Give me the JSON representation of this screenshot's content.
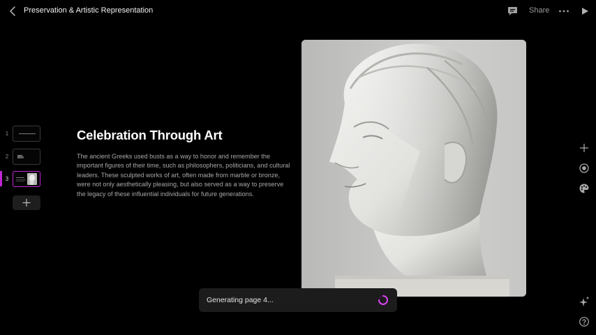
{
  "header": {
    "title": "Preservation & Artistic Representation",
    "share_label": "Share",
    "icons": [
      "chevron-left-icon",
      "comment-icon",
      "more-icon",
      "play-icon"
    ]
  },
  "slides": {
    "items": [
      {
        "number": "1"
      },
      {
        "number": "2"
      },
      {
        "number": "3",
        "active": true
      }
    ],
    "accent_color": "#c026d3"
  },
  "main": {
    "heading": "Celebration Through Art",
    "paragraph": "The ancient Greeks used busts as a way to honor and remember the important figures of their time, such as philosophers, politicians, and cultural leaders. These sculpted works of art, often made from marble or bronze, were not only aesthetically pleasing, but also served as a way to preserve the legacy of these influential individuals for future generations."
  },
  "toolbar": {
    "icons": [
      "plus-icon",
      "record-icon",
      "palette-icon",
      "sparkle-icon",
      "help-icon"
    ]
  },
  "toast": {
    "text": "Generating page 4..."
  }
}
